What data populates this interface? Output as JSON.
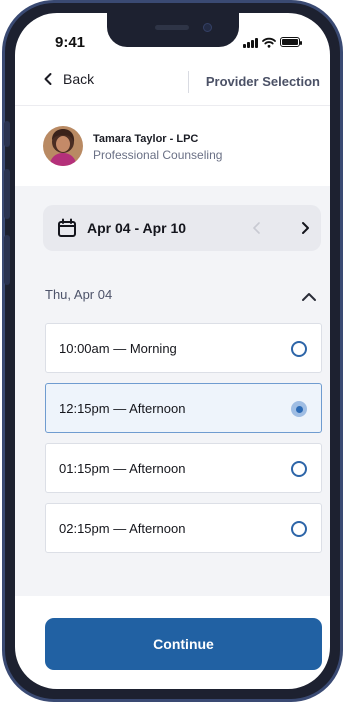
{
  "status_bar": {
    "time": "9:41"
  },
  "nav": {
    "back_label": "Back",
    "title": "Provider Selection"
  },
  "provider": {
    "name": "Tamara Taylor - LPC",
    "specialty": "Professional Counseling",
    "avatar_icon": "profile-photo"
  },
  "date_picker": {
    "range": "Apr 04 - Apr 10",
    "prev_enabled": false,
    "next_enabled": true
  },
  "day": {
    "label": "Thu, Apr 04",
    "slots": [
      {
        "label": "10:00am — Morning",
        "selected": false
      },
      {
        "label": "12:15pm — Afternoon",
        "selected": true
      },
      {
        "label": "01:15pm — Afternoon",
        "selected": false
      },
      {
        "label": "02:15pm — Afternoon",
        "selected": false
      }
    ]
  },
  "footer": {
    "continue_label": "Continue"
  },
  "colors": {
    "primary": "#2161a3",
    "accent_selected": "#eef4fb",
    "frame": "#3a4a73"
  }
}
